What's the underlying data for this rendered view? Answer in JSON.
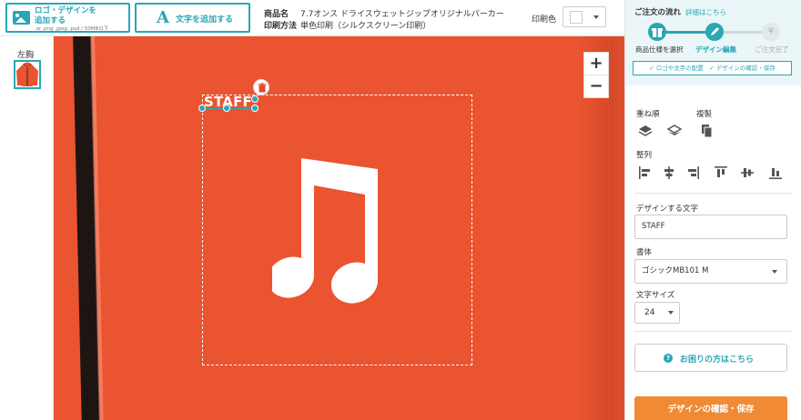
{
  "toolbar": {
    "upload_line1": "ロゴ・デザインを",
    "upload_line2": "追加する",
    "upload_formats": ".ai .png .jpeg .psd / 50MB以下",
    "add_text_glyph": "A",
    "add_text_label": "文字を追加する",
    "product_label": "商品名",
    "product_value": "7.7オンス ドライスウェットジップオリジナルパーカー",
    "print_method_label": "印刷方法",
    "print_method_value": "単色印刷（シルクスクリーン印刷）",
    "print_color_label": "印刷色",
    "print_color_value": "#ffffff"
  },
  "thumbnails": {
    "label": "左胸",
    "garment_color": "#ea5430"
  },
  "canvas": {
    "garment_color": "#ea5430",
    "zoom_in": "+",
    "zoom_out": "−",
    "text_object": "STAFF",
    "accent": "#2aa6b6"
  },
  "order_flow": {
    "title": "ご注文の流れ",
    "details_link": "詳細はこちら",
    "steps": [
      {
        "label": "商品仕様を選択",
        "state": "done"
      },
      {
        "label": "デザイン編集",
        "state": "current"
      },
      {
        "label": "ご注文完了",
        "state": "pending"
      }
    ],
    "hint": "✓ ロゴや文字の配置　✓ デザインの確認・保存"
  },
  "panel": {
    "layer_order_label": "重ね順",
    "duplicate_label": "複製",
    "align_label": "整列",
    "text_label": "デザインする文字",
    "text_value": "STAFF",
    "font_label": "書体",
    "font_value": "ゴシックMB101 M",
    "size_label": "文字サイズ",
    "size_value": "24",
    "help_icon": "?",
    "help_button": "お困りの方はこちら",
    "save_button": "デザインの確認・保存",
    "save_color": "#f08a34"
  }
}
